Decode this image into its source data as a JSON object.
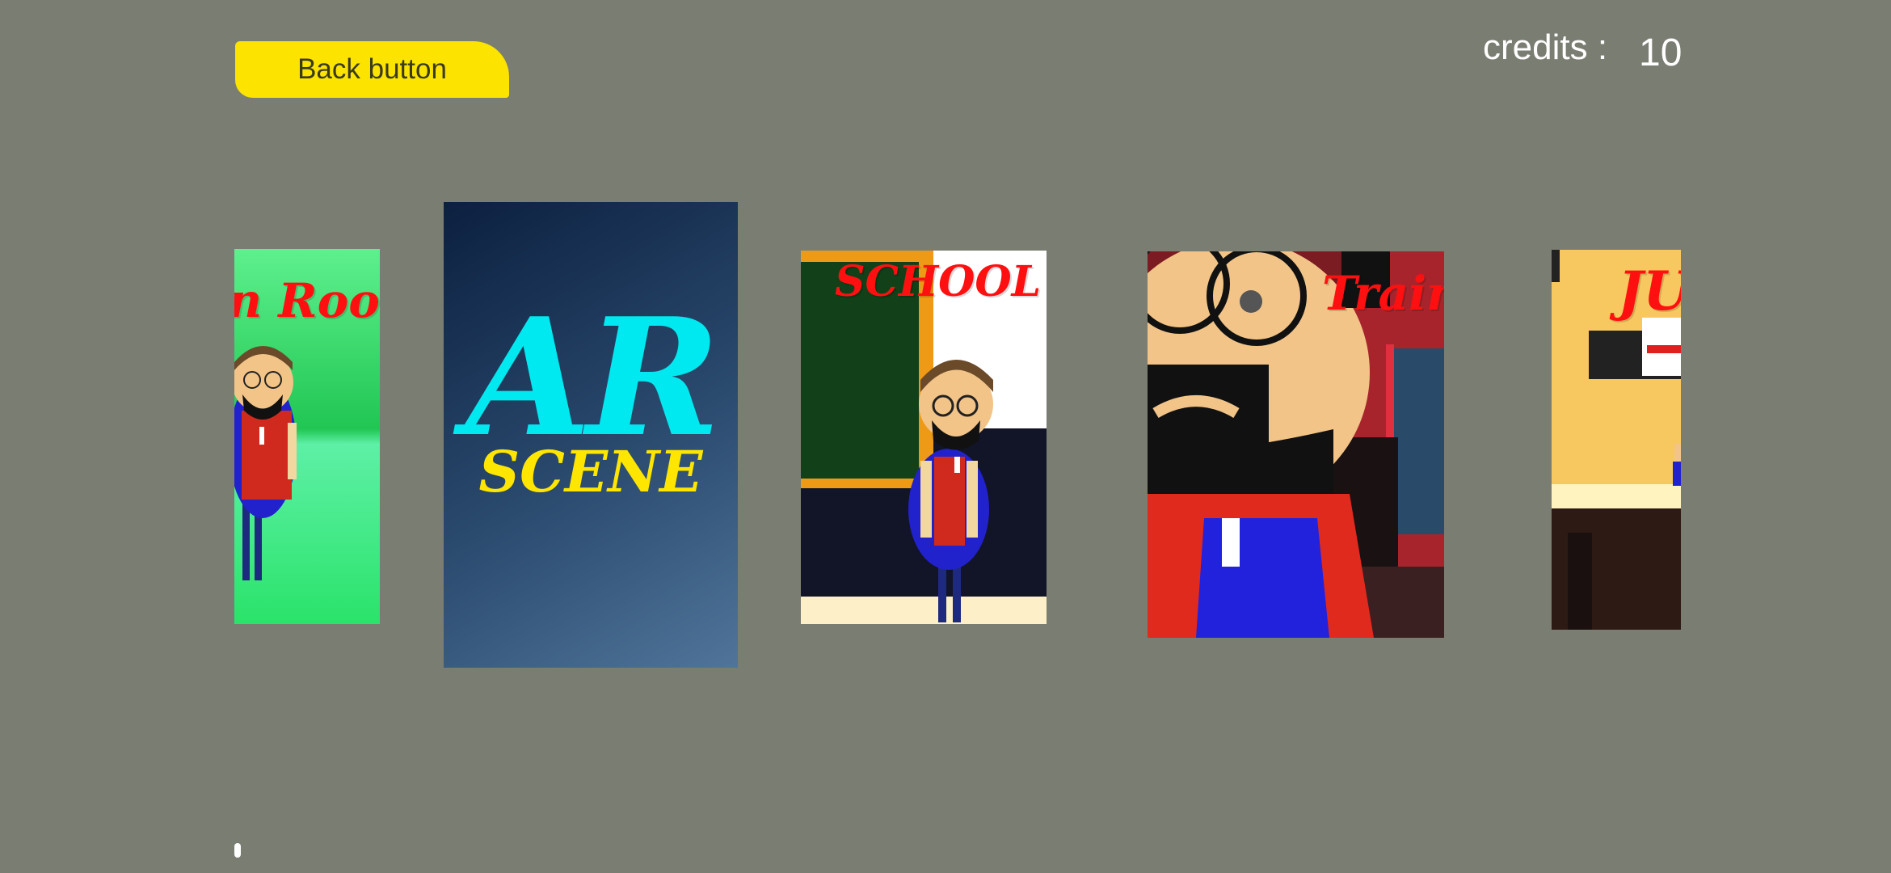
{
  "header": {
    "back_label": "Back button",
    "credits_label": "credits :",
    "credits_value": "10"
  },
  "scenes": [
    {
      "title": "n Room"
    },
    {
      "title_main": "AR",
      "title_sub": "SCENE"
    },
    {
      "title": "SCHOOL"
    },
    {
      "title": "Train"
    },
    {
      "title": "JU"
    }
  ],
  "colors": {
    "background": "#7a7d71",
    "button": "#fde300",
    "title_red": "#ff1010",
    "ar_cyan": "#00e8f0",
    "ar_yellow": "#ffe600"
  }
}
